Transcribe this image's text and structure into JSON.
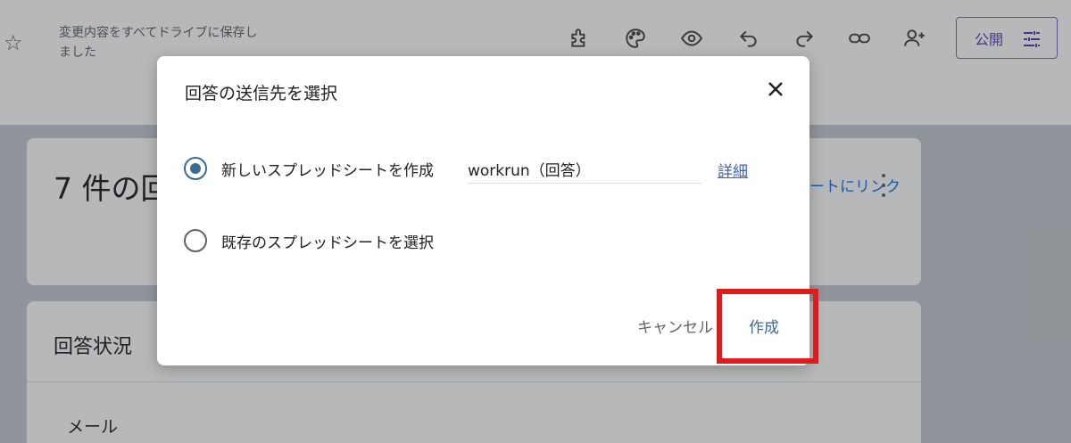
{
  "header": {
    "save_status": "変更内容をすべてドライブに保存しました",
    "publish_label": "公開",
    "icons": [
      "addons-icon",
      "palette-icon",
      "preview-icon",
      "undo-icon",
      "redo-icon",
      "link-icon",
      "add-person-icon",
      "tune-icon"
    ]
  },
  "background": {
    "card1_title": "7 件の回答",
    "card1_link": "シートにリンク",
    "card2_title": "回答状況",
    "card2_row": "メール"
  },
  "dialog": {
    "title": "回答の送信先を選択",
    "option_new": "新しいスプレッドシートを作成",
    "sheet_name": "workrun（回答）",
    "details_link": "詳細",
    "option_existing": "既存のスプレッドシートを選択",
    "cancel_label": "キャンセル",
    "create_label": "作成",
    "selected_option": "new"
  },
  "colors": {
    "accent": "#3c6a93",
    "highlight": "#e01b1b",
    "publish": "#5b3fb7"
  }
}
